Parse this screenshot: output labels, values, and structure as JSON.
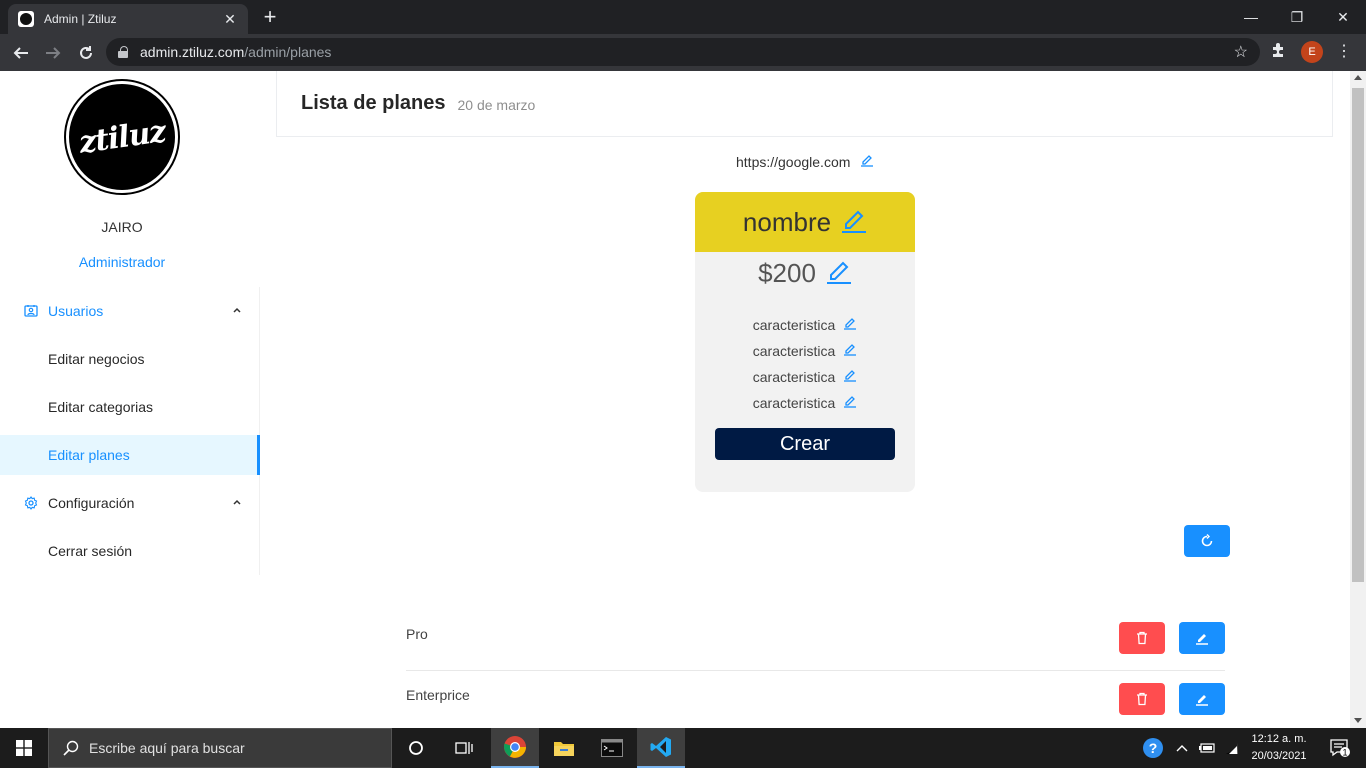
{
  "browser": {
    "tab_title": "Admin | Ztiluz",
    "tab_close": "✕",
    "new_tab": "+",
    "url_host": "admin.ztiluz.com",
    "url_path": "/admin/planes",
    "profile_initial": "E",
    "controls": {
      "minimize": "—",
      "restore": "❐",
      "close": "✕"
    }
  },
  "sidebar": {
    "logo_text": "ztiluz",
    "user_name": "JAIRO",
    "user_role": "Administrador",
    "menu": [
      {
        "label": "Usuarios",
        "icon": "user-card-icon",
        "expanded": true
      },
      {
        "label": "Editar negocios"
      },
      {
        "label": "Editar categorias"
      },
      {
        "label": "Editar planes",
        "active": true
      },
      {
        "label": "Configuración",
        "icon": "gear-icon",
        "expanded": true
      },
      {
        "label": "Cerrar sesión"
      }
    ]
  },
  "header": {
    "title": "Lista de planes",
    "subtitle": "20 de marzo"
  },
  "link": {
    "url": "https://google.com"
  },
  "plan_card": {
    "name": "nombre",
    "price": "$200",
    "features": [
      "caracteristica",
      "caracteristica",
      "caracteristica",
      "caracteristica"
    ],
    "create_label": "Crear",
    "header_color": "#e7d021"
  },
  "plans": [
    {
      "name": "Pro"
    },
    {
      "name": "Enterprice"
    }
  ],
  "taskbar": {
    "search_placeholder": "Escribe aquí para buscar",
    "time": "12:12 a. m.",
    "date": "20/03/2021",
    "notifications": "1"
  },
  "colors": {
    "accent": "#1890ff",
    "danger": "#ff4d4f",
    "primary_dark": "#001a44"
  }
}
